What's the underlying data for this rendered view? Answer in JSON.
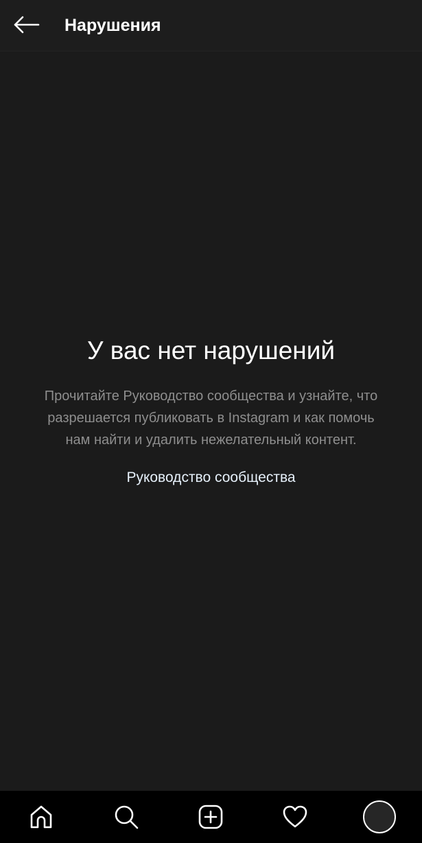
{
  "header": {
    "title": "Нарушения",
    "back_icon": "arrow-left-icon"
  },
  "empty_state": {
    "title": "У вас нет нарушений",
    "description": "Прочитайте Руководство сообщества и узнайте, что разрешается публиковать в Instagram и как помочь нам найти и удалить нежелательный контент.",
    "link_label": "Руководство сообщества"
  },
  "bottom_nav": {
    "items": [
      {
        "icon": "home-icon"
      },
      {
        "icon": "search-icon"
      },
      {
        "icon": "add-post-icon"
      },
      {
        "icon": "heart-icon"
      },
      {
        "icon": "profile-avatar-icon"
      }
    ]
  },
  "colors": {
    "background": "#1b1b1b",
    "header_background": "#1d1d1d",
    "nav_background": "#000000",
    "primary_text": "#ffffff",
    "secondary_text": "#8e8e8e",
    "link_text": "#e6f0fa"
  }
}
